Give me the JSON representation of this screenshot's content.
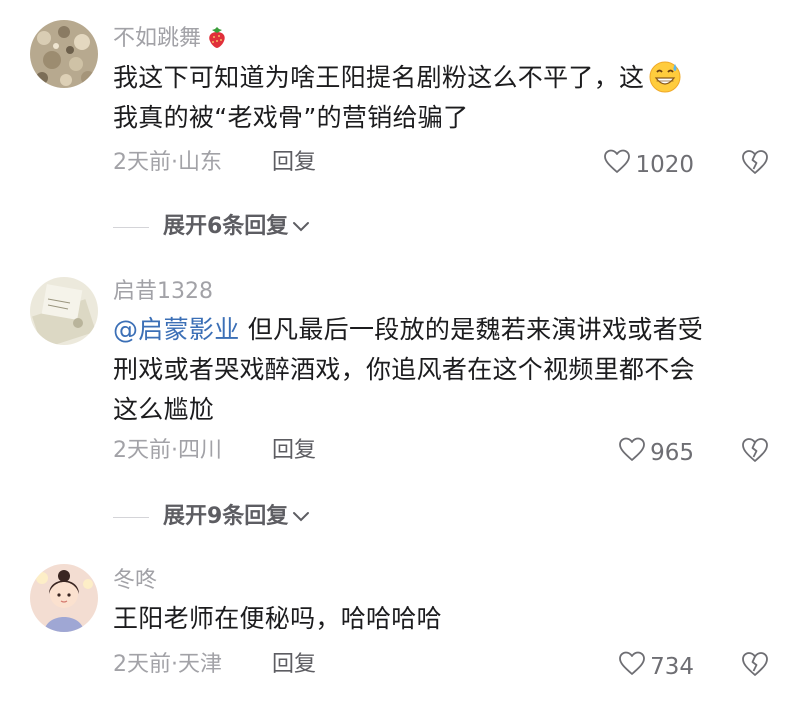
{
  "comments": [
    {
      "username": "不如跳舞",
      "text_line1": "我这下可知道为啥王阳提名剧粉这么不平了，这",
      "text_line2": "我真的被“老戏骨”的营销给骗了",
      "date_location": "2天前·山东",
      "reply_label": "回复",
      "likes": "1020",
      "expand_label": "展开6条回复"
    },
    {
      "username": "启昔1328",
      "mention": "@启蒙影业",
      "text_line1": " 但凡最后一段放的是魏若来演讲戏或者受",
      "text_line2": "刑戏或者哭戏醉酒戏，你追风者在这个视频里都不会",
      "text_line3": "这么尴尬",
      "date_location": "2天前·四川",
      "reply_label": "回复",
      "likes": "965",
      "expand_label": "展开9条回复"
    },
    {
      "username": "冬咚",
      "text_line1": "王阳老师在便秘吗，哈哈哈哈",
      "date_location": "2天前·天津",
      "reply_label": "回复",
      "likes": "734"
    }
  ],
  "icons": {
    "like": "heart-outline-icon",
    "dislike": "broken-heart-icon",
    "expand": "chevron-down-icon",
    "badge": "strawberry-icon",
    "emoji": "grinning-sweat-emoji"
  },
  "colors": {
    "mention": "#3b6fb6",
    "meta": "#a2a2a7",
    "text": "#1c1c1e"
  }
}
